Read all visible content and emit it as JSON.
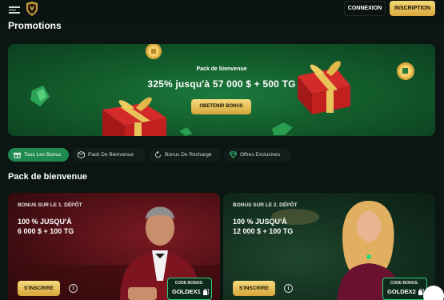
{
  "header": {
    "connexion_label": "CONNEXION",
    "inscription_label": "INSCRIPTION"
  },
  "page": {
    "title": "Promotions"
  },
  "hero": {
    "subtitle": "Pack de bienvenue",
    "title": "325% jusqu'à 57 000 $ + 500 TG",
    "button_label": "OBETENIR BONUS"
  },
  "tabs": [
    {
      "label": "Tous Les Bonus",
      "icon": "gift-icon",
      "active": true
    },
    {
      "label": "Pack De Bienvenue",
      "icon": "package-icon",
      "active": false
    },
    {
      "label": "Bonus De Recharge",
      "icon": "refresh-icon",
      "active": false
    },
    {
      "label": "Offres Exclusives",
      "icon": "diamond-icon",
      "active": false
    }
  ],
  "section": {
    "title": "Pack de bienvenue"
  },
  "cards": [
    {
      "subtitle": "BONUS SUR LE 1. DÉPÔT",
      "line1": "100 % JUSQU'À",
      "line2": "6 000 $ + 100 TG",
      "button_label": "S'INSCRIRE",
      "code_label": "CODE BONUS:",
      "code": "GOLDEX1"
    },
    {
      "subtitle": "BONUS SUR LE 2. DÉPÔT",
      "line1": "100 % JUSQU'À",
      "line2": "12 000 $ + 100 TG",
      "button_label": "S'INSCRIRE",
      "code_label": "CODE BONUS:",
      "code": "GOLDEX2"
    }
  ],
  "colors": {
    "background": "#0b1512",
    "accent_gold": "#e8c35a",
    "accent_green": "#1f8a4f"
  }
}
